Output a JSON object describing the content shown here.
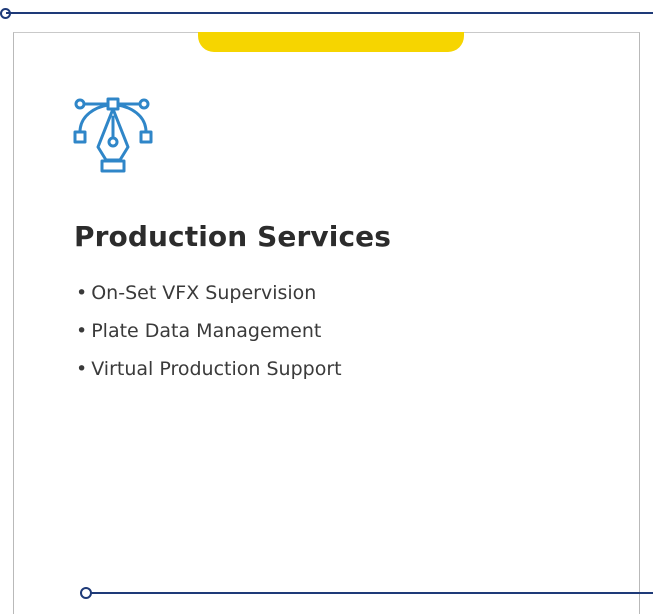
{
  "card": {
    "title": "Production Services",
    "items": [
      {
        "bullet": "•",
        "label": "On-Set VFX Supervision"
      },
      {
        "bullet": "•",
        "label": "Plate Data Management"
      },
      {
        "bullet": "•",
        "label": "Virtual Production Support"
      }
    ],
    "icon": "vector-pen-tool-icon"
  },
  "colors": {
    "accent_yellow": "#f6d500",
    "line_navy": "#1e3a78",
    "icon_blue": "#2f86c8",
    "title_text": "#2c2c2c"
  }
}
